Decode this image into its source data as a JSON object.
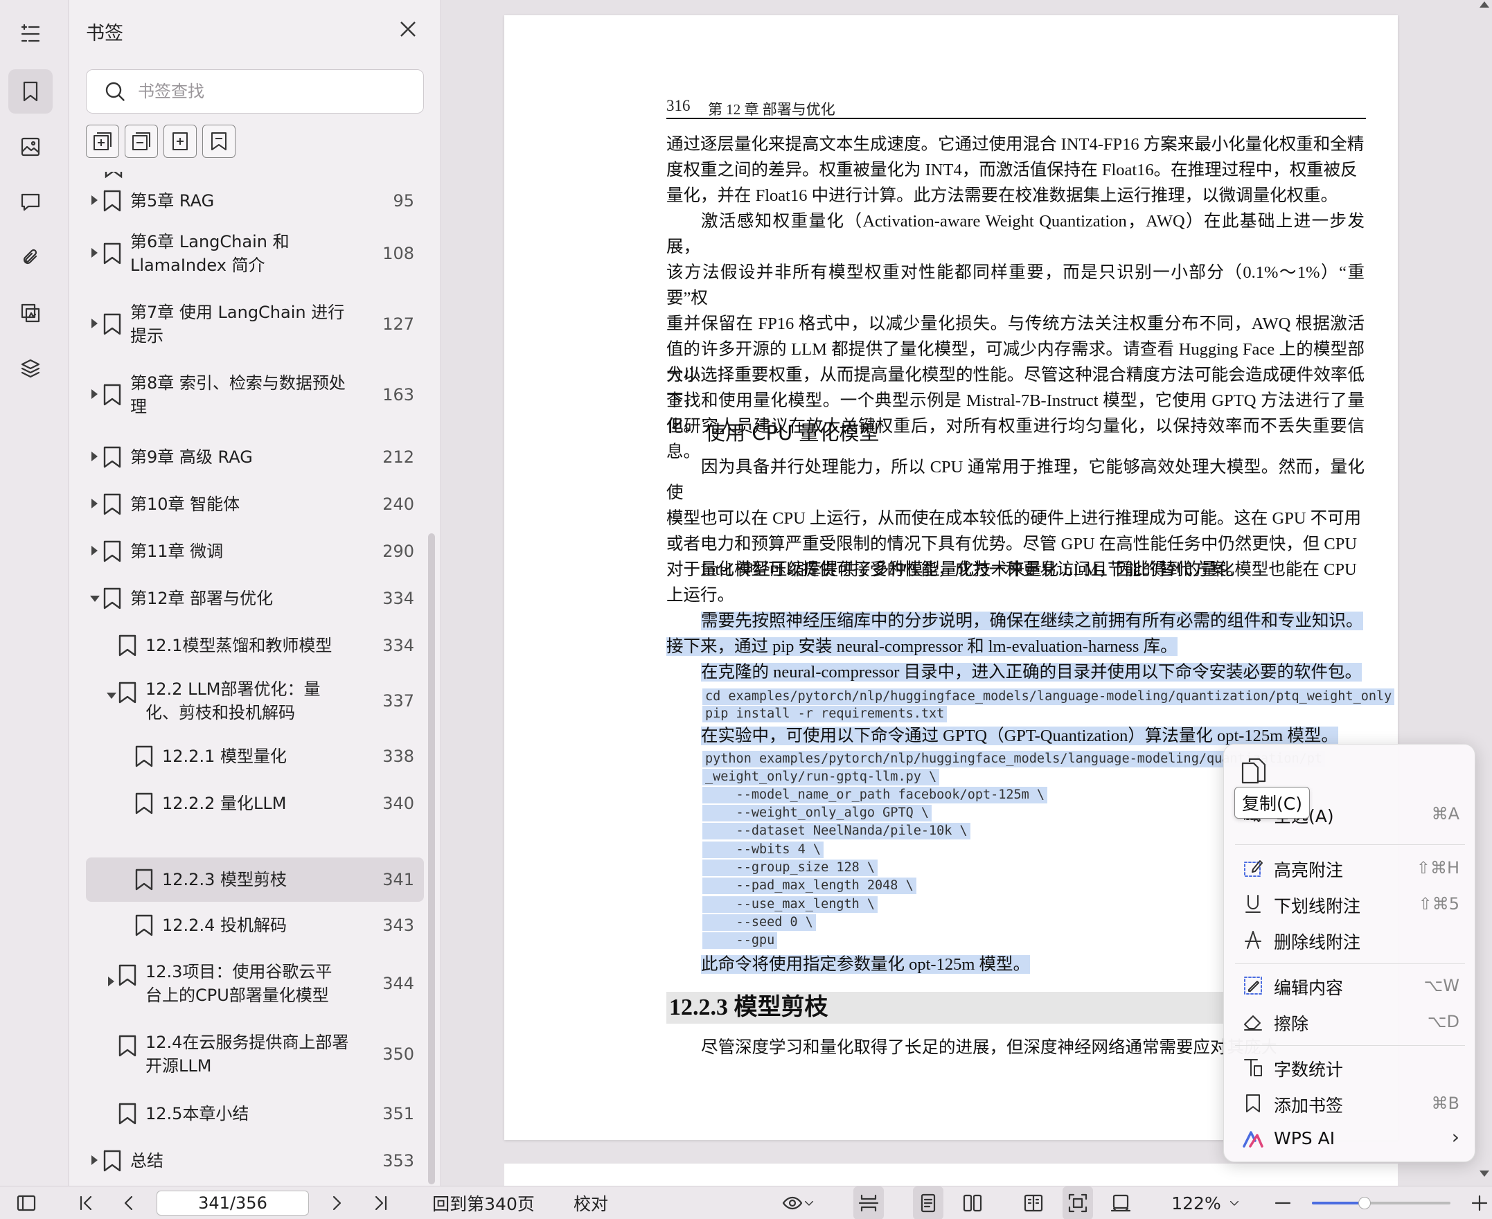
{
  "sidebar_panel": {
    "title": "书签",
    "search_placeholder": "书签查找",
    "items": [
      {
        "label": "第5章  RAG",
        "page": "95",
        "level": 0,
        "state": "collapsed"
      },
      {
        "label": "第6章  LangChain 和 LlamaIndex 简介",
        "page": "108",
        "level": 0,
        "state": "collapsed"
      },
      {
        "label": "第7章  使用 LangChain 进行提示",
        "page": "127",
        "level": 0,
        "state": "collapsed"
      },
      {
        "label": "第8章  索引、检索与数据预处理",
        "page": "163",
        "level": 0,
        "state": "collapsed"
      },
      {
        "label": "第9章  高级 RAG",
        "page": "212",
        "level": 0,
        "state": "collapsed"
      },
      {
        "label": "第10章  智能体",
        "page": "240",
        "level": 0,
        "state": "collapsed"
      },
      {
        "label": "第11章  微调",
        "page": "290",
        "level": 0,
        "state": "collapsed"
      },
      {
        "label": "第12章  部署与优化",
        "page": "334",
        "level": 0,
        "state": "expanded"
      },
      {
        "label": "12.1模型蒸馏和教师模型",
        "page": "334",
        "level": 1,
        "state": "leaf"
      },
      {
        "label": "12.2  LLM部署优化：量化、剪枝和投机解码",
        "page": "337",
        "level": 1,
        "state": "expanded"
      },
      {
        "label": "12.2.1    模型量化",
        "page": "338",
        "level": 2,
        "state": "leaf"
      },
      {
        "label": "12.2.2    量化LLM",
        "page": "340",
        "level": 2,
        "state": "leaf"
      },
      {
        "label": "12.2.3    模型剪枝",
        "page": "341",
        "level": 2,
        "state": "leaf",
        "selected": true
      },
      {
        "label": "12.2.4    投机解码",
        "page": "343",
        "level": 2,
        "state": "leaf"
      },
      {
        "label": "12.3项目：使用谷歌云平台上的CPU部署量化模型",
        "page": "344",
        "level": 1,
        "state": "collapsed"
      },
      {
        "label": "12.4在云服务提供商上部署开源LLM",
        "page": "350",
        "level": 1,
        "state": "leaf"
      },
      {
        "label": "12.5本章小结",
        "page": "351",
        "level": 1,
        "state": "leaf"
      },
      {
        "label": "总结",
        "page": "353",
        "level": 0,
        "state": "collapsed"
      }
    ]
  },
  "document": {
    "header_page": "316",
    "header_chapter": "第 12 章    部署与优化",
    "p1_l1": "通过逐层量化来提高文本生成速度。它通过使用混合 INT4-FP16 方案来最小化量化权重和全精",
    "p1_l2": "度权重之间的差异。权重被量化为 INT4，而激活值保持在 Float16。在推理过程中，权重被反",
    "p1_l3": "量化，并在 Float16 中进行计算。此方法需要在校准数据集上运行推理，以微调量化权重。",
    "p2_l1": "激活感知权重量化（Activation-aware Weight Quantization，AWQ）在此基础上进一步发展，",
    "p2_l2": "该方法假设并非所有模型权重对性能都同样重要，而是只识别一小部分（0.1%～1%）“重要”权",
    "p2_l3": "重并保留在 FP16 格式中，以减少量化损失。与传统方法关注权重分布不同，AWQ 根据激活值的",
    "p2_l4": "大小选择重要权重，从而提高量化模型的性能。尽管这种混合精度方法可能会造成硬件效率低下，",
    "p2_l5": "但研究人员建议在放大关键权重后，对所有权重进行均匀量化，以保持效率而不丢失重要信息。",
    "p3_l1": "许多开源的 LLM 都提供了量化模型，可减少内存需求。请查看 Hugging Face 上的模型部分以",
    "p3_l2": "查找和使用量化模型。一个典型示例是 Mistral-7B-Instruct 模型，它使用 GPTQ 方法进行了量化。",
    "subheading": "使用 CPU 量化模型",
    "p4_l1": "因为具备并行处理能力，所以 CPU 通常用于推理，它能够高效处理大模型。然而，量化使",
    "p4_l2": "模型也可以在 CPU 上运行，从而使在成本较低的硬件上进行推理成为可能。这在 GPU 不可用",
    "p4_l3": "或者电力和预算严重受限制的情况下具有优势。尽管 GPU 在高性能任务中仍然更快，但 CPU",
    "p4_l4": "对于量化模型可以提供可接受的性能，成为一种更易访问且节能的替代方案。",
    "p5_l1": "Intel 神经压缩库提供了多种模型量化技术来量化 LLM，因此得到的量化模型也能在 CPU",
    "p5_l2": "上运行。",
    "p6_l1": "需要先按照神经压缩库中的分步说明，确保在继续之前拥有所有必需的组件和专业知识。",
    "p6_l2": "接下来，通过 pip 安装 neural-compressor 和 lm-evaluation-harness 库。",
    "p7": "在克隆的 neural-compressor 目录中，进入正确的目录并使用以下命令安装必要的软件包。",
    "code1_l1": "cd examples/pytorch/nlp/huggingface_models/language-modeling/quantization/ptq_weight_only",
    "code1_l2": "pip install -r requirements.txt",
    "p8": "在实验中，可使用以下命令通过 GPTQ（GPT-Quantization）算法量化 opt-125m 模型。",
    "code2_l1": "python examples/pytorch/nlp/huggingface_models/language-modeling/quantization/pt",
    "code2_l2": "_weight_only/run-gptq-llm.py \\",
    "code2_l3": "    --model_name_or_path facebook/opt-125m \\",
    "code2_l4": "    --weight_only_algo GPTQ \\",
    "code2_l5": "    --dataset NeelNanda/pile-10k \\",
    "code2_l6": "    --wbits 4 \\",
    "code2_l7": "    --group_size 128 \\",
    "code2_l8": "    --pad_max_length 2048 \\",
    "code2_l9": "    --use_max_length \\",
    "code2_l10": "    --seed 0 \\",
    "code2_l11": "    --gpu",
    "p9": "此命令将使用指定参数量化 opt-125m 模型。",
    "section_heading": "12.2.3    模型剪枝",
    "p10": "尽管深度学习和量化取得了长足的进展，但深度神经网络通常需要应对其庞大的规模"
  },
  "context_menu": {
    "tooltip": "复制(C)",
    "items": [
      {
        "label": "全选(A)",
        "shortcut": "⌘A",
        "icon": "select-all-icon"
      },
      {
        "label": "高亮附注",
        "shortcut": "⇧⌘H",
        "icon": "highlight-icon"
      },
      {
        "label": "下划线附注",
        "shortcut": "⇧⌘5",
        "icon": "underline-icon"
      },
      {
        "label": "删除线附注",
        "shortcut": "",
        "icon": "strikethrough-icon"
      },
      {
        "label": "编辑内容",
        "shortcut": "⌥W",
        "icon": "edit-icon"
      },
      {
        "label": "擦除",
        "shortcut": "⌥D",
        "icon": "eraser-icon"
      },
      {
        "label": "字数统计",
        "shortcut": "",
        "icon": "word-count-icon"
      },
      {
        "label": "添加书签",
        "shortcut": "⌘B",
        "icon": "bookmark-icon"
      },
      {
        "label": "WPS AI",
        "shortcut": "",
        "icon": "wps-ai-icon"
      }
    ],
    "submenu_arrow": "›"
  },
  "statusbar": {
    "page_field": "341/356",
    "back_to_page": "回到第340页",
    "proofread": "校对",
    "zoom": "122%",
    "zoom_level": 0.38
  },
  "colors": {
    "selection": "#cbdcf5",
    "accent": "#4b6ce0"
  }
}
